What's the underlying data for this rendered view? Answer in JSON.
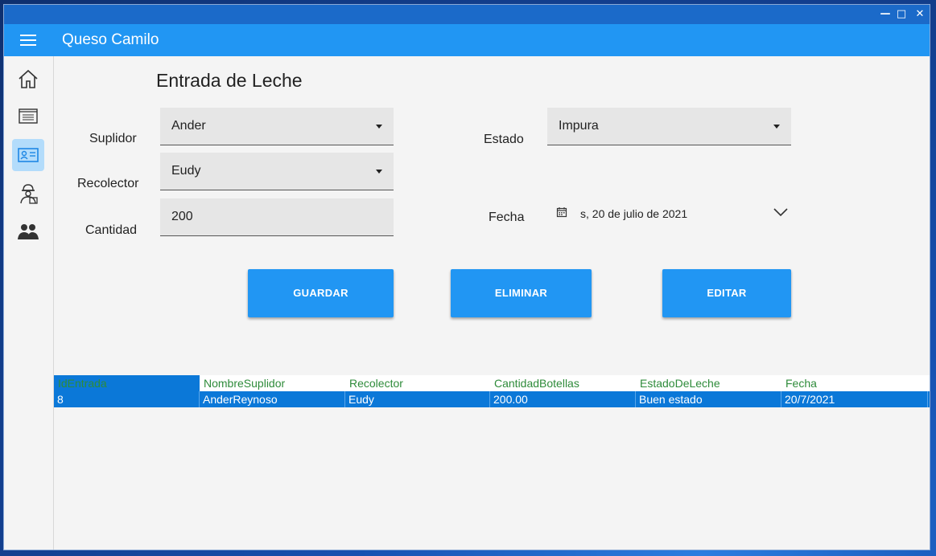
{
  "window": {
    "controls": {
      "minimize": "—",
      "maximize": "□",
      "close": "✕"
    }
  },
  "app": {
    "title": "Queso Camilo",
    "accent": "#2196f3"
  },
  "sidebar": {
    "items": [
      {
        "icon": "home-icon",
        "active": false
      },
      {
        "icon": "list-icon",
        "active": false
      },
      {
        "icon": "id-card-icon",
        "active": true
      },
      {
        "icon": "worker-icon",
        "active": false
      },
      {
        "icon": "group-icon",
        "active": false
      }
    ]
  },
  "page": {
    "title": "Entrada de Leche"
  },
  "form": {
    "suplidor": {
      "label": "Suplidor",
      "value": "Ander"
    },
    "recolector": {
      "label": "Recolector",
      "value": "Eudy"
    },
    "cantidad": {
      "label": "Cantidad",
      "value": "200"
    },
    "estado": {
      "label": "Estado",
      "value": "Impura"
    },
    "fecha": {
      "label": "Fecha",
      "value": "s, 20 de julio de 2021"
    }
  },
  "buttons": {
    "guardar": "GUARDAR",
    "eliminar": "ELIMINAR",
    "editar": "EDITAR"
  },
  "table": {
    "columns": [
      "IdEntrada",
      "NombreSuplidor",
      "Recolector",
      "CantidadBotellas",
      "EstadoDeLeche",
      "Fecha"
    ],
    "rows": [
      [
        "8",
        "AnderReynoso",
        "Eudy",
        "200.00",
        "Buen estado",
        "20/7/2021"
      ]
    ]
  }
}
